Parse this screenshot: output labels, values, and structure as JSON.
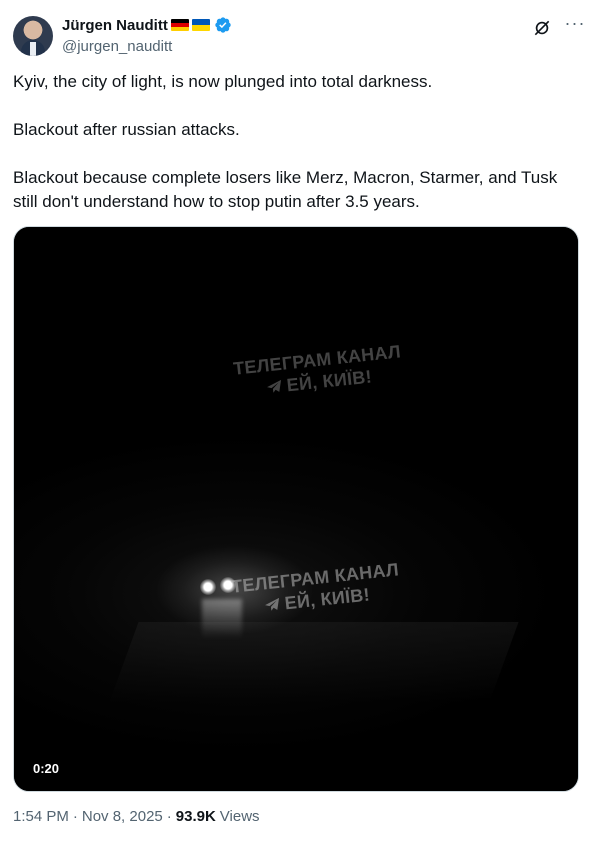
{
  "author": {
    "name": "Jürgen Nauditt",
    "handle": "@jurgen_nauditt",
    "flags": [
      "germany-flag",
      "ukraine-flag"
    ],
    "verified": true
  },
  "tweet": {
    "paragraphs": [
      "Kyiv, the city of light, is now plunged into total darkness.",
      "Blackout after russian attacks.",
      "Blackout because complete losers like Merz, Macron, Starmer, and Tusk still don't understand how to stop putin after 3.5 years."
    ]
  },
  "media": {
    "watermark_line1": "ТЕЛЕГРАМ КАНАЛ",
    "watermark_line2": "ЕЙ, КИЇВ!",
    "duration": "0:20"
  },
  "meta": {
    "time": "1:54 PM",
    "separator": "·",
    "date": "Nov 8, 2025",
    "views_count": "93.9K",
    "views_label": "Views"
  },
  "colors": {
    "text_primary": "#0f1419",
    "text_secondary": "#536471",
    "verified_blue": "#1d9bf0",
    "border": "#cfd9de"
  }
}
